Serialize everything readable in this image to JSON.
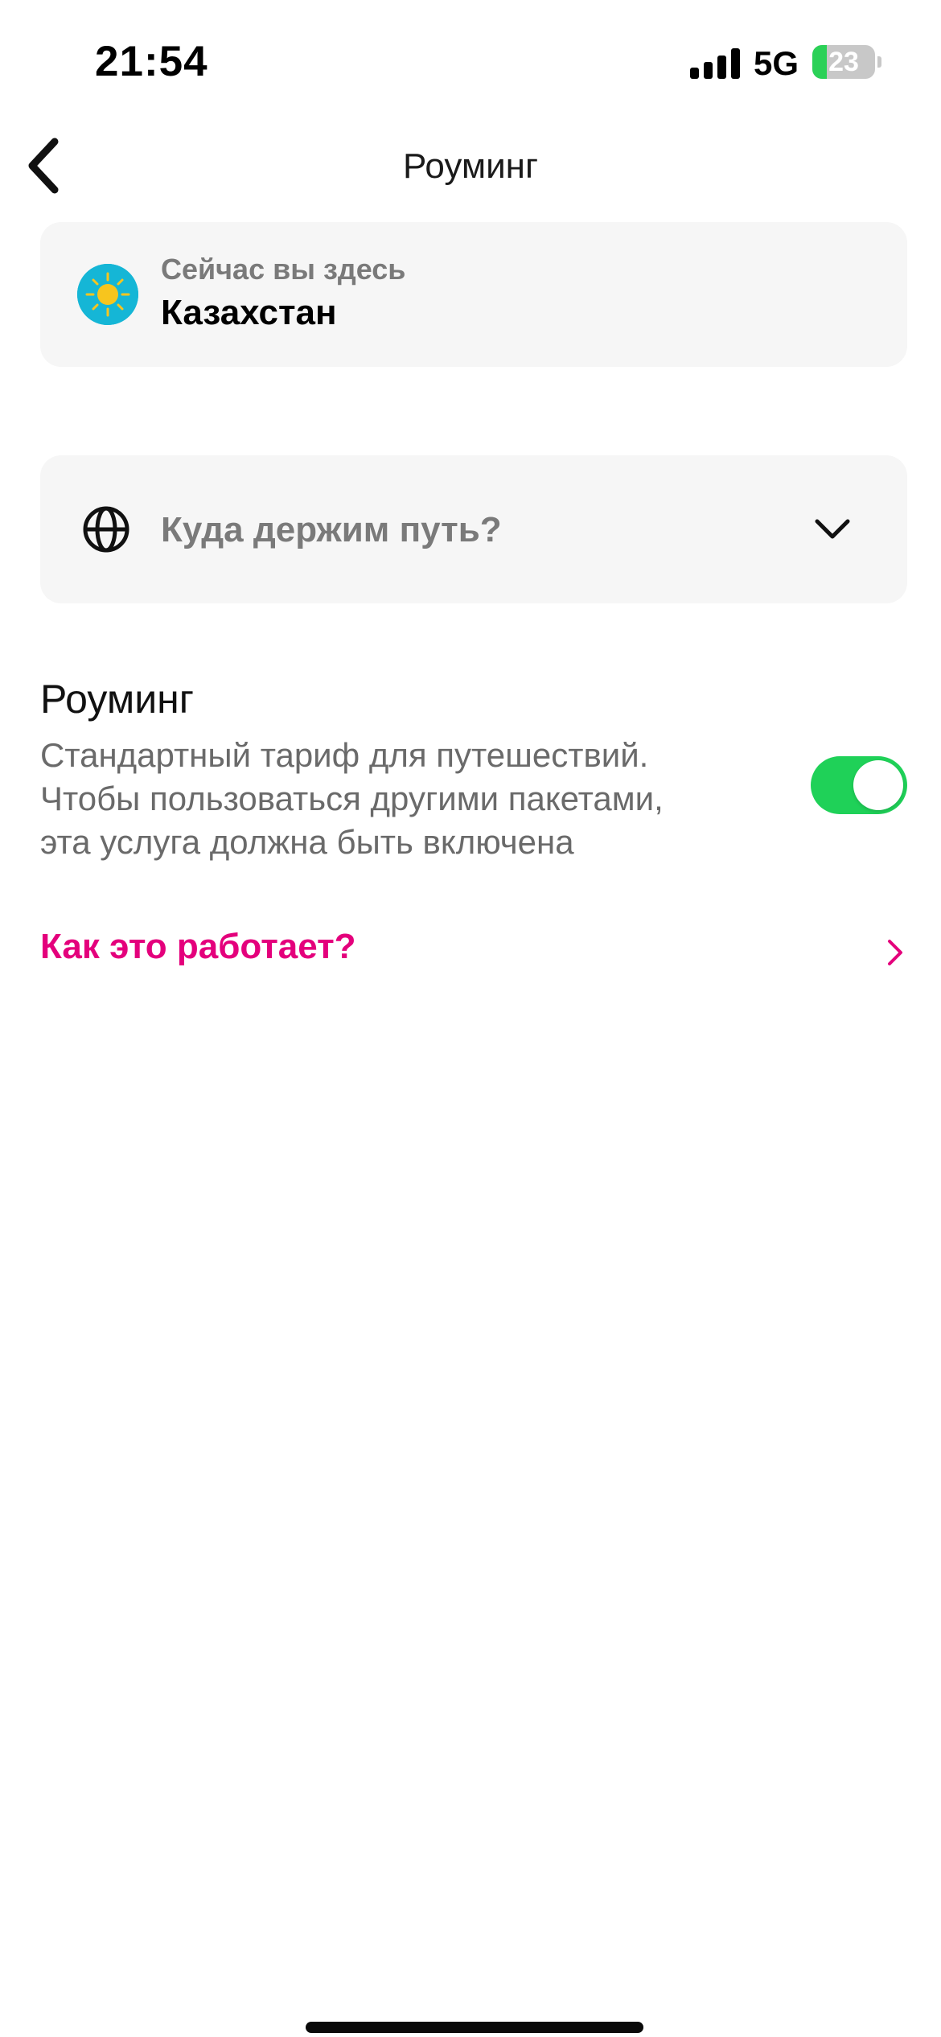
{
  "status_bar": {
    "time": "21:54",
    "network": "5G",
    "battery_level": "23",
    "battery_fraction": 0.23
  },
  "nav": {
    "title": "Роуминг"
  },
  "location_card": {
    "caption": "Сейчас вы здесь",
    "country": "Казахстан",
    "flag_icon": "kazakhstan-flag-icon"
  },
  "destination_selector": {
    "placeholder": "Куда держим путь?",
    "icon": "globe-icon"
  },
  "roaming": {
    "title": "Роуминг",
    "description_lines": [
      "Стандартный тариф для путешествий.",
      "Чтобы пользоваться другими пакетами,",
      "эта услуга должна быть включена"
    ],
    "enabled": true
  },
  "how_it_works": {
    "label": "Как это работает?"
  },
  "colors": {
    "accent": "#e4007c",
    "toggle_on": "#1fd158",
    "card_bg": "#f6f6f6",
    "secondary_text": "#7a7a7a"
  }
}
